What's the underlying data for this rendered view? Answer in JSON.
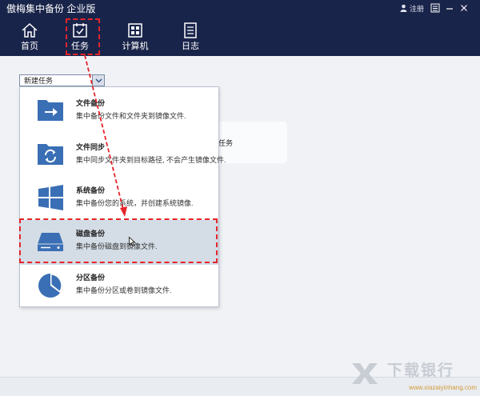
{
  "window": {
    "title": "傲梅集中备份 企业版",
    "login_label": "注册"
  },
  "nav": {
    "items": [
      {
        "label": "首页",
        "icon": "home-icon"
      },
      {
        "label": "任务",
        "icon": "task-icon"
      },
      {
        "label": "计算机",
        "icon": "computer-icon"
      },
      {
        "label": "日志",
        "icon": "log-icon"
      }
    ]
  },
  "task_dropdown": {
    "value": "新建任务"
  },
  "background_card": {
    "text": "任务"
  },
  "menu": {
    "items": [
      {
        "title": "文件备份",
        "desc": "集中备份文件和文件夹到镜像文件.",
        "icon": "file-backup-icon"
      },
      {
        "title": "文件同步",
        "desc": "集中同步文件夹到目标路径, 不会产生镜像文件.",
        "icon": "file-sync-icon"
      },
      {
        "title": "系统备份",
        "desc": "集中备份您的系统，并创建系统镜像.",
        "icon": "system-backup-icon"
      },
      {
        "title": "磁盘备份",
        "desc": "集中备份磁盘到镜像文件.",
        "icon": "disk-backup-icon"
      },
      {
        "title": "分区备份",
        "desc": "集中备份分区或卷到镜像文件.",
        "icon": "partition-backup-icon"
      }
    ],
    "selected_index": 3
  },
  "watermark": {
    "brand": "下载银行",
    "subtitle": "www.xiazaiyinhang.com"
  },
  "colors": {
    "titlebar": "#19244a",
    "accent": "#3a6fb5",
    "highlight": "#e5242b"
  }
}
